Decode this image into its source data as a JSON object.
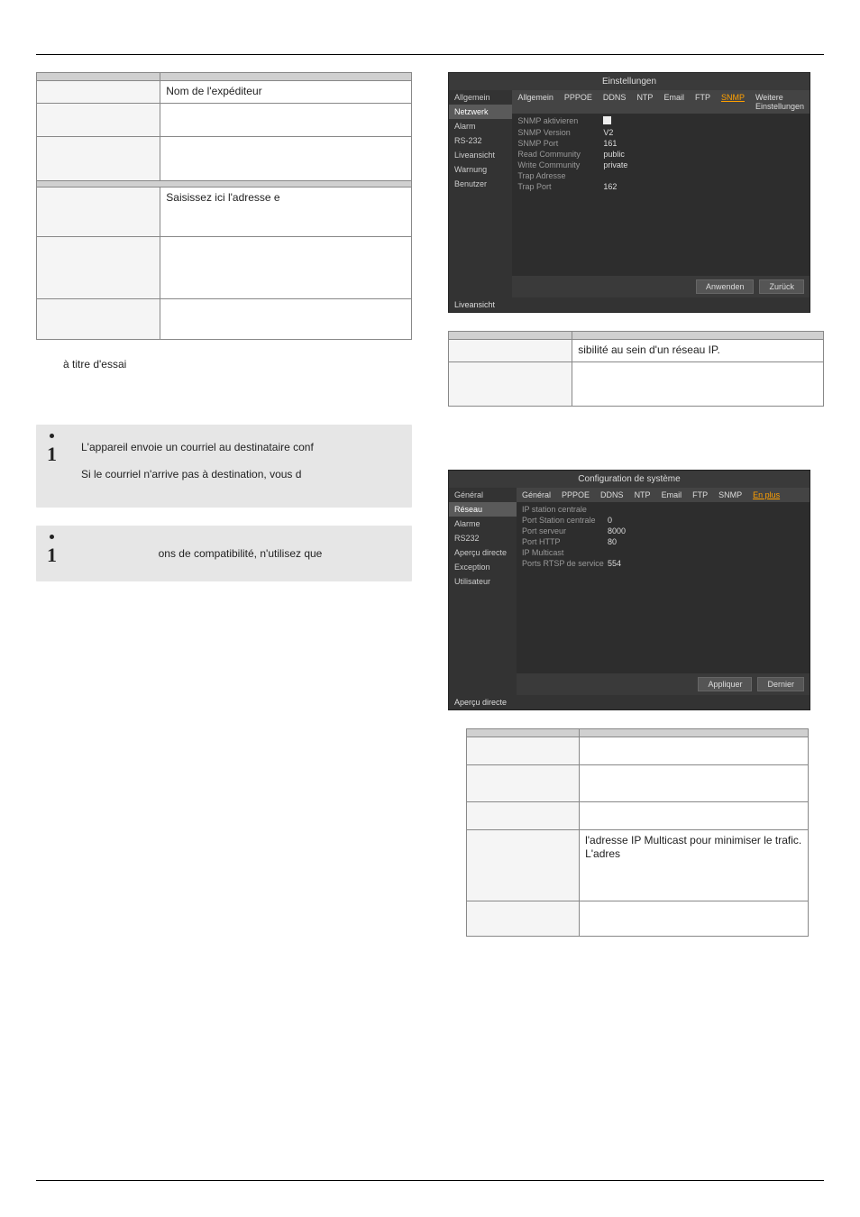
{
  "left_table": {
    "rows": [
      {
        "k": "",
        "v": ""
      },
      {
        "k": "",
        "v": "Nom de l'expéditeur"
      },
      {
        "k": "",
        "v": ""
      },
      {
        "k": "",
        "v": ""
      },
      {
        "k": "",
        "v": "Saisissez ici l'adresse e"
      },
      {
        "k": "",
        "v": ""
      },
      {
        "k": "",
        "v": ""
      }
    ]
  },
  "sub_note": "à titre d'essai",
  "info1_line1": "L'appareil envoie un courriel au destinataire conf",
  "info1_line2": "Si le courriel n'arrive pas à destination, vous d",
  "info2_line": "ons de compatibilité, n'utilisez que",
  "shot1": {
    "title": "Einstellungen",
    "sidebar": [
      "Allgemein",
      "Netzwerk",
      "Alarm",
      "RS-232",
      "Liveansicht",
      "Warnung",
      "Benutzer"
    ],
    "sidebar_active": 1,
    "tabs": [
      "Allgemein",
      "PPPOE",
      "DDNS",
      "NTP",
      "Email",
      "FTP",
      "SNMP",
      "Weitere Einstellungen"
    ],
    "tabs_active": 6,
    "fields": [
      {
        "label": "SNMP aktivieren",
        "value": "checkbox"
      },
      {
        "label": "SNMP Version",
        "value": "V2"
      },
      {
        "label": "SNMP Port",
        "value": "161"
      },
      {
        "label": "Read Community",
        "value": "public"
      },
      {
        "label": "Write Community",
        "value": "private"
      },
      {
        "label": "Trap Adresse",
        "value": ""
      },
      {
        "label": "Trap Port",
        "value": "162"
      }
    ],
    "live_back": "Liveansicht",
    "btn_apply": "Anwenden",
    "btn_back": "Zurück"
  },
  "right_table1": {
    "rows": [
      {
        "k": "",
        "v": ""
      },
      {
        "k": "",
        "v": "sibilité au sein d'un réseau IP."
      },
      {
        "k": "",
        "v": ""
      }
    ]
  },
  "shot2": {
    "title": "Configuration de système",
    "sidebar": [
      "Général",
      "Réseau",
      "Alarme",
      "RS232",
      "Aperçu directe",
      "Exception",
      "Utilisateur"
    ],
    "sidebar_active": 1,
    "tabs": [
      "Général",
      "PPPOE",
      "DDNS",
      "NTP",
      "Email",
      "FTP",
      "SNMP",
      "En plus"
    ],
    "tabs_active": 7,
    "fields": [
      {
        "label": "IP station centrale",
        "value": ""
      },
      {
        "label": "Port Station centrale",
        "value": "0"
      },
      {
        "label": "Port serveur",
        "value": "8000"
      },
      {
        "label": "Port HTTP",
        "value": "80"
      },
      {
        "label": "IP Multicast",
        "value": ""
      },
      {
        "label": "Ports RTSP de service",
        "value": "554"
      }
    ],
    "live_back": "Aperçu directe",
    "btn_apply": "Appliquer",
    "btn_back": "Dernier"
  },
  "right_table2": {
    "rows": [
      {
        "k": "",
        "v": ""
      },
      {
        "k": "",
        "v": ""
      },
      {
        "k": "",
        "v": ""
      },
      {
        "k": "",
        "v": ""
      },
      {
        "k": "",
        "v": "l'adresse IP Multicast pour minimiser le trafic. L'adres"
      },
      {
        "k": "",
        "v": ""
      }
    ]
  },
  "chart_data": null
}
